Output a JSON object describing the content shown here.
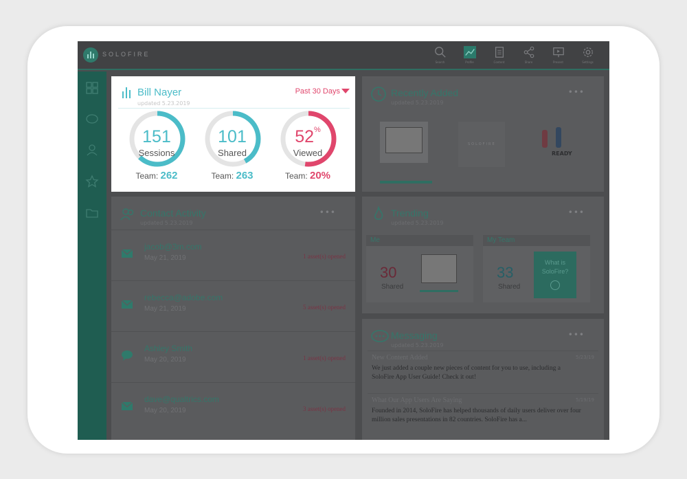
{
  "app": {
    "logo_text": "SOLOFIRE"
  },
  "topnav": [
    {
      "label": "Search",
      "icon": "search-icon"
    },
    {
      "label": "Profile",
      "icon": "chart-icon",
      "active": true
    },
    {
      "label": "Content",
      "icon": "document-icon"
    },
    {
      "label": "Share",
      "icon": "share-icon"
    },
    {
      "label": "Present",
      "icon": "present-icon"
    },
    {
      "label": "Settings",
      "icon": "gear-icon"
    }
  ],
  "profile": {
    "name": "Bill Nayer",
    "updated": "updated 5.23.2019",
    "range": "Past 30 Days",
    "metrics": [
      {
        "value": "151",
        "label": "Sessions",
        "team_label": "Team:",
        "team_value": "262",
        "fraction": 0.62,
        "color": "#4bbcc8"
      },
      {
        "value": "101",
        "label": "Shared",
        "team_label": "Team:",
        "team_value": "263",
        "fraction": 0.42,
        "color": "#4bbcc8"
      },
      {
        "value": "52",
        "suffix": "%",
        "label": "Viewed",
        "team_label": "Team:",
        "team_value": "20%",
        "fraction": 0.52,
        "color": "#e0466c"
      }
    ]
  },
  "recently_added": {
    "title": "Recently Added",
    "updated": "updated 5.23.2019",
    "thumb_caption": "READY",
    "logo_text": "SOLOFIRE"
  },
  "contact_activity": {
    "title": "Contact Activity",
    "updated": "updated 5.23.2019",
    "rows": [
      {
        "name": "jacob@3m.com",
        "date": "May 21, 2019",
        "opened": "1 asset(s) opened",
        "icon": "mail-icon"
      },
      {
        "name": "rebecca@adobe.com",
        "date": "May 21, 2019",
        "opened": "5 asset(s) opened",
        "icon": "mail-icon"
      },
      {
        "name": "Ashley Smith",
        "date": "May 20, 2019",
        "opened": "1 asset(s) opened",
        "icon": "chat-icon"
      },
      {
        "name": "dave@qualtrics.com",
        "date": "May 20, 2019",
        "opened": "3 asset(s) opened",
        "icon": "mail-icon"
      }
    ]
  },
  "trending": {
    "title": "Trending",
    "updated": "updated 5.23.2019",
    "me": {
      "header": "Me",
      "value": "30",
      "label": "Shared"
    },
    "team": {
      "header": "My Team",
      "value": "33",
      "label": "Shared",
      "tile": "What is SoloFire?"
    }
  },
  "messaging": {
    "title": "Messaging",
    "updated": "updated 5.23.2019",
    "messages": [
      {
        "title": "New Content Added",
        "date": "5/23/19",
        "body": "We just added a couple new pieces of content for you to use, including a SoloFire App User Guide! Check it out!"
      },
      {
        "title": "What Our App Users Are Saying",
        "date": "5/19/19",
        "body": "Founded in 2014, SoloFire has helped thousands of daily users deliver over four million sales presentations in 82 countries. SoloFire has a..."
      }
    ]
  },
  "more_label": "•••"
}
